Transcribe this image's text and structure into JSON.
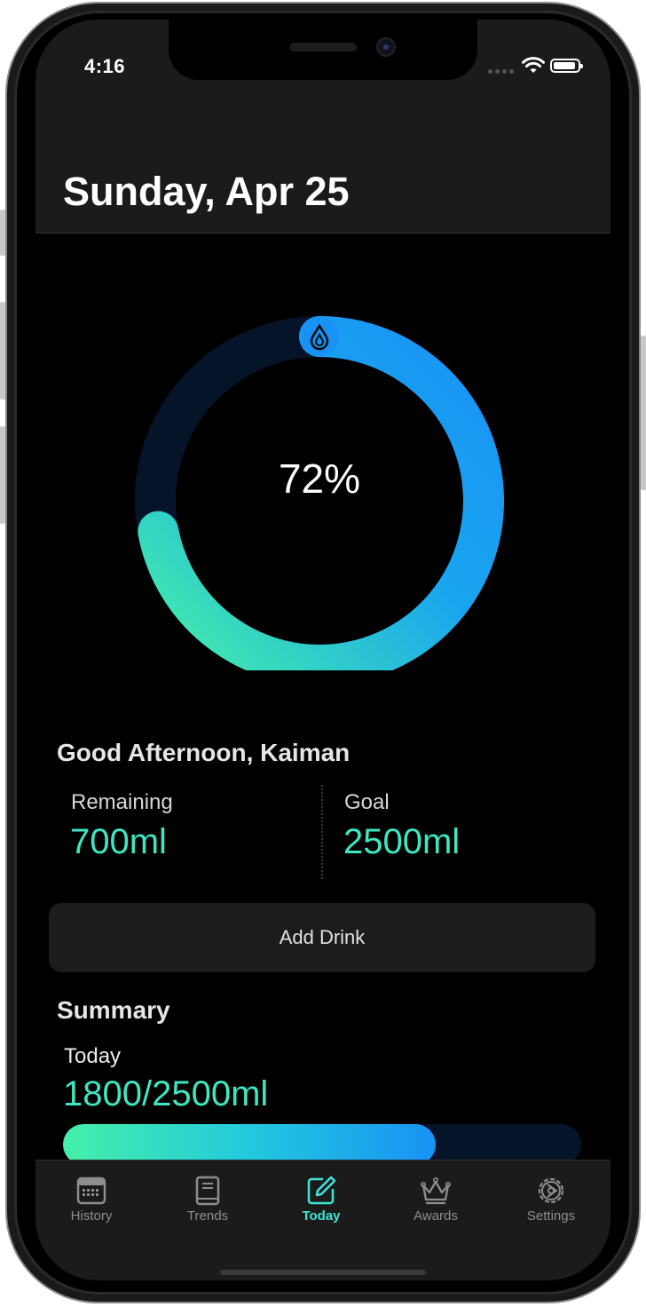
{
  "status_bar": {
    "time": "4:16"
  },
  "header": {
    "title": "Sunday, Apr 25"
  },
  "progress": {
    "percent_label": "72%",
    "fraction": 0.72
  },
  "greeting": "Good Afternoon, Kaiman",
  "stats": {
    "remaining_label": "Remaining",
    "remaining_value": "700ml",
    "goal_label": "Goal",
    "goal_value": "2500ml"
  },
  "add_drink_label": "Add Drink",
  "summary": {
    "title": "Summary",
    "today_label": "Today",
    "today_value": "1800/2500ml",
    "fill_fraction": 0.72
  },
  "tabs": [
    {
      "label": "History",
      "icon": "calendar-icon"
    },
    {
      "label": "Trends",
      "icon": "book-icon"
    },
    {
      "label": "Today",
      "icon": "edit-icon",
      "active": true
    },
    {
      "label": "Awards",
      "icon": "crown-icon"
    },
    {
      "label": "Settings",
      "icon": "gear-icon"
    }
  ],
  "colors": {
    "accent": "#3ee6c1",
    "ring_start": "#46f0a8",
    "ring_end": "#1892f5",
    "ring_track": "#06142a",
    "background": "#000000"
  }
}
